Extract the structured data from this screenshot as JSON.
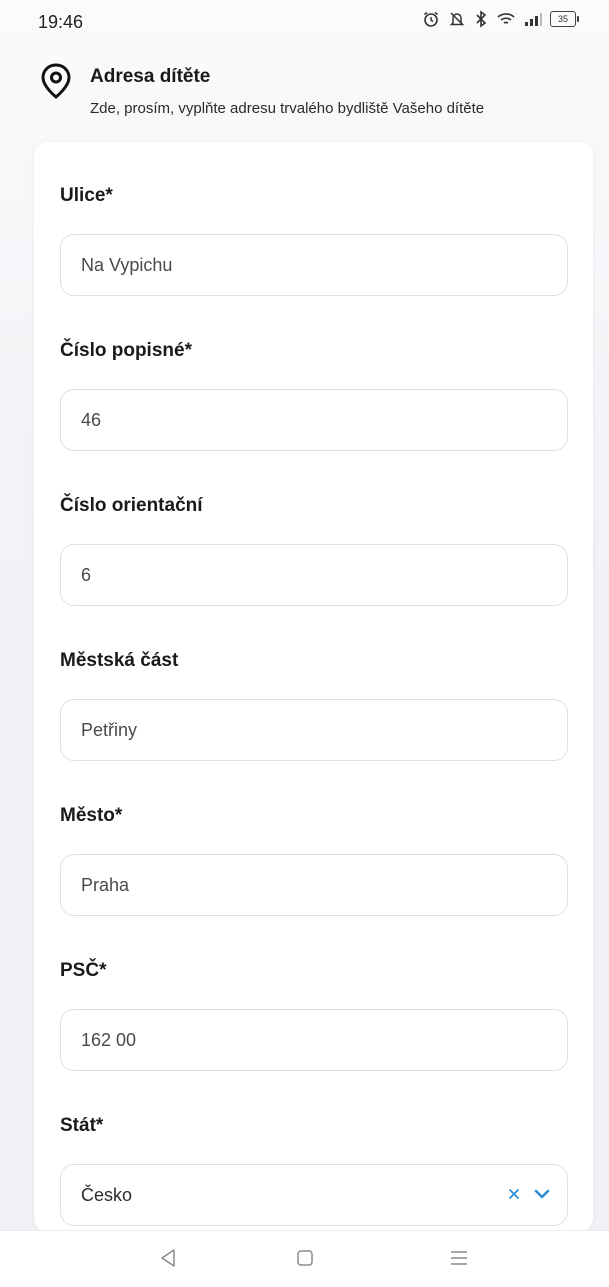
{
  "status_bar": {
    "time": "19:46",
    "battery": "35",
    "icons": [
      "alarm-icon",
      "mute-icon",
      "bluetooth-icon",
      "wifi-icon",
      "signal-icon",
      "battery-icon"
    ]
  },
  "header": {
    "icon": "location-pin-icon",
    "title": "Adresa dítěte",
    "subtitle": "Zde, prosím, vyplňte adresu trvalého bydliště Vašeho dítěte"
  },
  "form": {
    "fields": [
      {
        "label": "Ulice*",
        "value": "Na Vypichu"
      },
      {
        "label": "Číslo popisné*",
        "value": "46"
      },
      {
        "label": "Číslo orientační",
        "value": "6"
      },
      {
        "label": "Městská část",
        "value": "Petřiny"
      },
      {
        "label": "Město*",
        "value": "Praha"
      },
      {
        "label": "PSČ*",
        "value": "162 00"
      }
    ],
    "country": {
      "label": "Stát*",
      "value": "Česko"
    }
  },
  "colors": {
    "accent": "#2f8fd8",
    "border": "#dedfe4",
    "background": "#f2f2f6"
  },
  "nav_bar": {
    "items": [
      "back-icon",
      "home-icon",
      "menu-icon"
    ]
  }
}
